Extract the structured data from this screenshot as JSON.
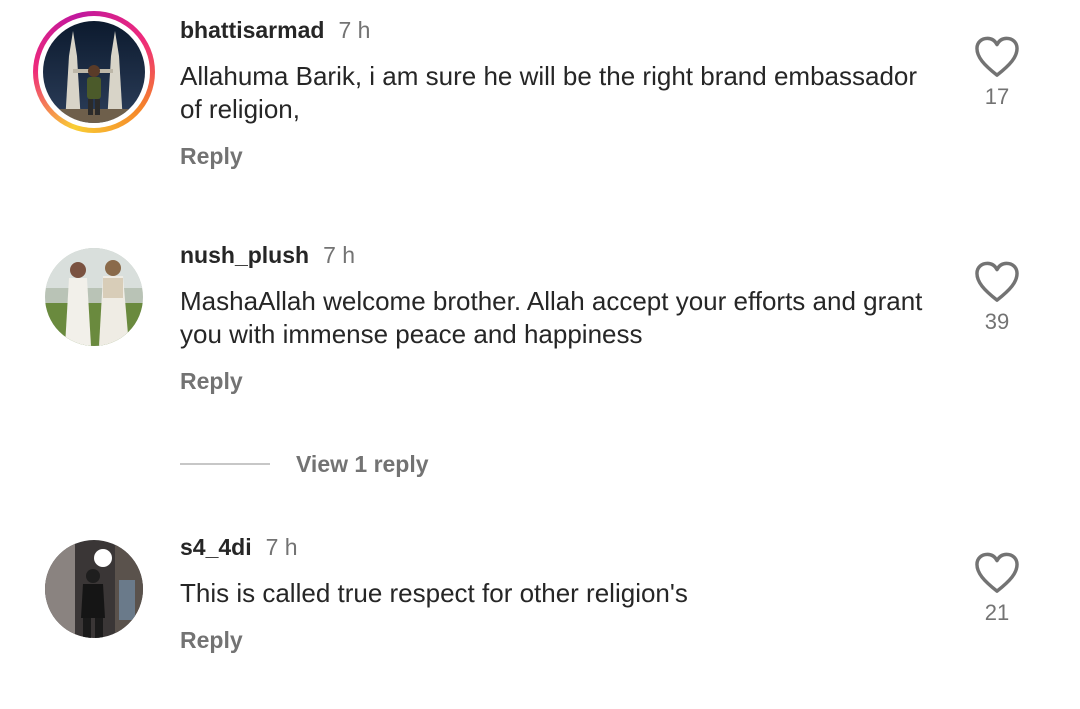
{
  "colors": {
    "text_primary": "#262626",
    "text_secondary": "#737373",
    "story_ring_start": "#f9ce34",
    "story_ring_mid": "#ee2a7b"
  },
  "comments": [
    {
      "username": "bhattisarmad",
      "time": "7 h",
      "text": "Allahuma Barik, i am sure he will be the right brand embassador of religion,",
      "reply_label": "Reply",
      "likes": "17",
      "has_story_ring": true,
      "avatar_icon": "avatar-photo-towers"
    },
    {
      "username": "nush_plush",
      "time": "7 h",
      "text": "MashaAllah welcome brother. Allah accept your efforts and grant you with immense peace and happiness",
      "reply_label": "Reply",
      "likes": "39",
      "has_story_ring": false,
      "avatar_icon": "avatar-photo-dresses"
    },
    {
      "username": "s4_4di",
      "time": "7 h",
      "text": "This is called true respect for other religion's",
      "reply_label": "Reply",
      "likes": "21",
      "has_story_ring": false,
      "avatar_icon": "avatar-photo-mirror"
    }
  ],
  "view_replies_label": "View 1 reply",
  "icons": {
    "like": "heart-outline-icon"
  }
}
